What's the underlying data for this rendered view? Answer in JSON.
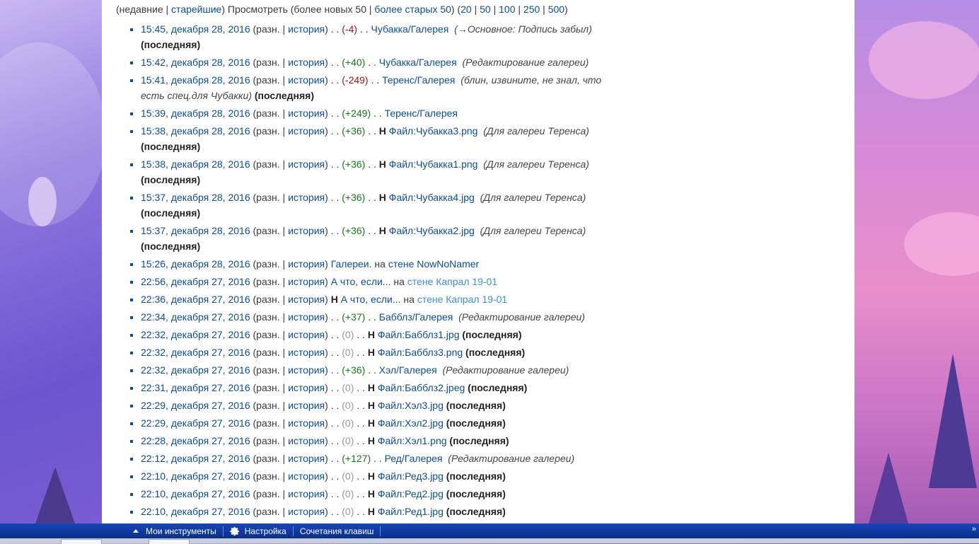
{
  "nav": {
    "paren_open": "(",
    "recent": "недавние",
    "sep1": " | ",
    "oldest": "старейшие",
    "view_text": ") Просмотреть (более новых 50 | ",
    "older": "более старых 50",
    "close_open": ") (",
    "limits": [
      "20",
      "50",
      "100",
      "250",
      "500"
    ],
    "close": ")"
  },
  "entries": [
    {
      "time": "15:45, декабря 28, 2016",
      "diff": "разн.",
      "hist": "история",
      "dots": ". .",
      "size": "(-4)",
      "sign": "neg",
      "new": "",
      "page": "Чубакка/Галерея",
      "summary": "(→Основное: Подпись забыл)",
      "latest": "(последняя)"
    },
    {
      "time": "15:42, декабря 28, 2016",
      "diff": "разн.",
      "hist": "история",
      "dots": ". .",
      "size": "(+40)",
      "sign": "pos",
      "new": "",
      "page": "Чубакка/Галерея",
      "summary": "(Редактирование галереи)",
      "latest": ""
    },
    {
      "time": "15:41, декабря 28, 2016",
      "diff": "разн.",
      "hist": "история",
      "dots": ". .",
      "size": "(-249)",
      "sign": "neg",
      "new": "",
      "page": "Теренс/Галерея",
      "summary": "(блин, извините, не знал, что есть спец.для Чубакки)",
      "latest": "(последняя)"
    },
    {
      "time": "15:39, декабря 28, 2016",
      "diff": "разн.",
      "hist": "история",
      "dots": ". .",
      "size": "(+249)",
      "sign": "pos",
      "new": "",
      "page": "Теренс/Галерея",
      "summary": "",
      "latest": ""
    },
    {
      "time": "15:38, декабря 28, 2016",
      "diff": "разн.",
      "hist": "история",
      "dots": ". .",
      "size": "(+36)",
      "sign": "pos",
      "new": "Н",
      "page": "Файл:Чубакка3.png",
      "summary": "(Для галереи Теренса)",
      "latest": "(последняя)"
    },
    {
      "time": "15:38, декабря 28, 2016",
      "diff": "разн.",
      "hist": "история",
      "dots": ". .",
      "size": "(+36)",
      "sign": "pos",
      "new": "Н",
      "page": "Файл:Чубакка1.png",
      "summary": "(Для галереи Теренса)",
      "latest": "(последняя)"
    },
    {
      "time": "15:37, декабря 28, 2016",
      "diff": "разн.",
      "hist": "история",
      "dots": ". .",
      "size": "(+36)",
      "sign": "pos",
      "new": "Н",
      "page": "Файл:Чубакка4.jpg",
      "summary": "(Для галереи Теренса)",
      "latest": "(последняя)"
    },
    {
      "time": "15:37, декабря 28, 2016",
      "diff": "разн.",
      "hist": "история",
      "dots": ". .",
      "size": "(+36)",
      "sign": "pos",
      "new": "Н",
      "page": "Файл:Чубакка2.jpg",
      "summary": "(Для галереи Теренса)",
      "latest": "(последняя)"
    }
  ],
  "wall_entries": [
    {
      "time": "15:26, декабря 28, 2016",
      "diff": "разн.",
      "hist": "история",
      "new": "",
      "title": "Галереи.",
      "on": "на",
      "wall": "стене NowNoNamer",
      "light": false
    },
    {
      "time": "22:56, декабря 27, 2016",
      "diff": "разн.",
      "hist": "история",
      "new": "",
      "title": "А что, если...",
      "on": "на",
      "wall": "стене Капрал 19-01",
      "light": true
    },
    {
      "time": "22:36, декабря 27, 2016",
      "diff": "разн.",
      "hist": "история",
      "new": "Н",
      "title": "А что, если...",
      "on": "на",
      "wall": "стене Капрал 19-01",
      "light": true
    }
  ],
  "entries2": [
    {
      "time": "22:34, декабря 27, 2016",
      "diff": "разн.",
      "hist": "история",
      "dots": ". .",
      "size": "(+37)",
      "sign": "pos",
      "new": "",
      "page": "Бабблз/Галерея",
      "summary": "(Редактирование галереи)",
      "latest": ""
    },
    {
      "time": "22:32, декабря 27, 2016",
      "diff": "разн.",
      "hist": "история",
      "dots": ". .",
      "size": "(0)",
      "sign": "zero",
      "new": "Н",
      "page": "Файл:Бабблз1.jpg",
      "summary": "",
      "latest": "(последняя)"
    },
    {
      "time": "22:32, декабря 27, 2016",
      "diff": "разн.",
      "hist": "история",
      "dots": ". .",
      "size": "(0)",
      "sign": "zero",
      "new": "Н",
      "page": "Файл:Бабблз3.png",
      "summary": "",
      "latest": "(последняя)"
    },
    {
      "time": "22:32, декабря 27, 2016",
      "diff": "разн.",
      "hist": "история",
      "dots": ". .",
      "size": "(+36)",
      "sign": "pos",
      "new": "",
      "page": "Хэл/Галерея",
      "summary": "(Редактирование галереи)",
      "latest": ""
    },
    {
      "time": "22:31, декабря 27, 2016",
      "diff": "разн.",
      "hist": "история",
      "dots": ". .",
      "size": "(0)",
      "sign": "zero",
      "new": "Н",
      "page": "Файл:Бабблз2.jpeg",
      "summary": "",
      "latest": "(последняя)"
    },
    {
      "time": "22:29, декабря 27, 2016",
      "diff": "разн.",
      "hist": "история",
      "dots": ". .",
      "size": "(0)",
      "sign": "zero",
      "new": "Н",
      "page": "Файл:Хэл3.jpg",
      "summary": "",
      "latest": "(последняя)"
    },
    {
      "time": "22:29, декабря 27, 2016",
      "diff": "разн.",
      "hist": "история",
      "dots": ". .",
      "size": "(0)",
      "sign": "zero",
      "new": "Н",
      "page": "Файл:Хэл2.jpg",
      "summary": "",
      "latest": "(последняя)"
    },
    {
      "time": "22:28, декабря 27, 2016",
      "diff": "разн.",
      "hist": "история",
      "dots": ". .",
      "size": "(0)",
      "sign": "zero",
      "new": "Н",
      "page": "Файл:Хэл1.png",
      "summary": "",
      "latest": "(последняя)"
    },
    {
      "time": "22:12, декабря 27, 2016",
      "diff": "разн.",
      "hist": "история",
      "dots": ". .",
      "size": "(+127)",
      "sign": "pos",
      "new": "",
      "page": "Ред/Галерея",
      "summary": "(Редактирование галереи)",
      "latest": ""
    },
    {
      "time": "22:10, декабря 27, 2016",
      "diff": "разн.",
      "hist": "история",
      "dots": ". .",
      "size": "(0)",
      "sign": "zero",
      "new": "Н",
      "page": "Файл:Ред3.jpg",
      "summary": "",
      "latest": "(последняя)"
    },
    {
      "time": "22:10, декабря 27, 2016",
      "diff": "разн.",
      "hist": "история",
      "dots": ". .",
      "size": "(0)",
      "sign": "zero",
      "new": "Н",
      "page": "Файл:Ред2.jpg",
      "summary": "",
      "latest": "(последняя)"
    },
    {
      "time": "22:10, декабря 27, 2016",
      "diff": "разн.",
      "hist": "история",
      "dots": ". .",
      "size": "(0)",
      "sign": "zero",
      "new": "Н",
      "page": "Файл:Ред1.jpg",
      "summary": "",
      "latest": "(последняя)"
    }
  ],
  "toolbar": {
    "my_tools": "Мои инструменты",
    "settings": "Настройка",
    "shortcuts": "Сочетания клавиш",
    "collapse": "»"
  },
  "colors": {
    "link": "#0b4c9e",
    "positive": "#137a13",
    "negative": "#a01515",
    "toolbar": "#0a2f8a"
  }
}
